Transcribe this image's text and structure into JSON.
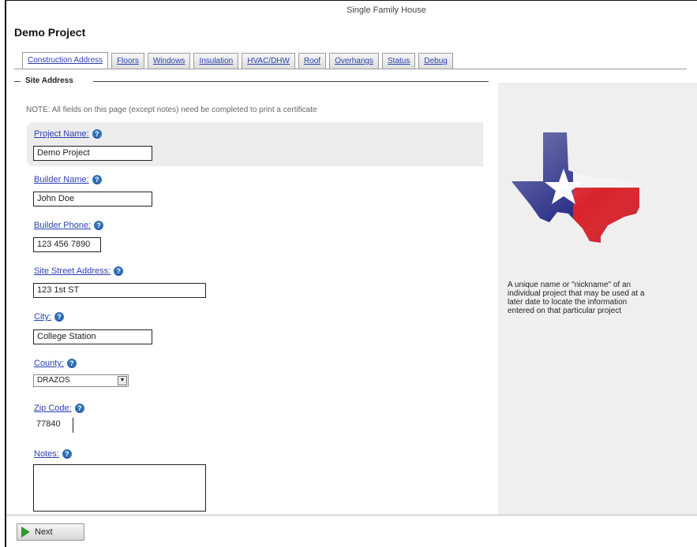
{
  "window": {
    "title": "Single Family House"
  },
  "project": {
    "title": "Demo Project"
  },
  "tabs": [
    {
      "label": "Construction Address",
      "active": true
    },
    {
      "label": "Floors",
      "active": false
    },
    {
      "label": "Windows",
      "active": false
    },
    {
      "label": "Insulation",
      "active": false
    },
    {
      "label": "HVAC/DHW",
      "active": false
    },
    {
      "label": "Roof",
      "active": false
    },
    {
      "label": "Overhangs",
      "active": false
    },
    {
      "label": "Status",
      "active": false
    },
    {
      "label": "Debug",
      "active": false
    }
  ],
  "section": {
    "legend": "Site Address",
    "note": "NOTE: All fields on this page (except notes) need be completed to print a certificate"
  },
  "fields": {
    "project_name": {
      "label": "Project Name:",
      "value": "Demo Project"
    },
    "builder_name": {
      "label": "Builder Name:",
      "value": "John Doe"
    },
    "builder_phone": {
      "label": "Builder Phone:",
      "value": "123 456 7890"
    },
    "site_street_address": {
      "label": "Site Street Address:",
      "value": "123 1st ST"
    },
    "city": {
      "label": "City:",
      "value": "College Station"
    },
    "county": {
      "label": "County:",
      "value": "DRAZOS"
    },
    "zip_code": {
      "label": "Zip Code:",
      "value": "77840"
    },
    "notes": {
      "label": "Notes:",
      "value": ""
    }
  },
  "help_icon_glyph": "?",
  "side_panel": {
    "help_text": "A unique name or \"nickname\" of an individual project that may be used at a later date to locate the information entered on that particular project"
  },
  "footer": {
    "next_label": "Next"
  },
  "colors": {
    "link": "#2b3fb0",
    "help_icon": "#2f6fb4",
    "panel": "#efefef",
    "texas_blue": "#2a2f86",
    "texas_red": "#d9232b"
  }
}
